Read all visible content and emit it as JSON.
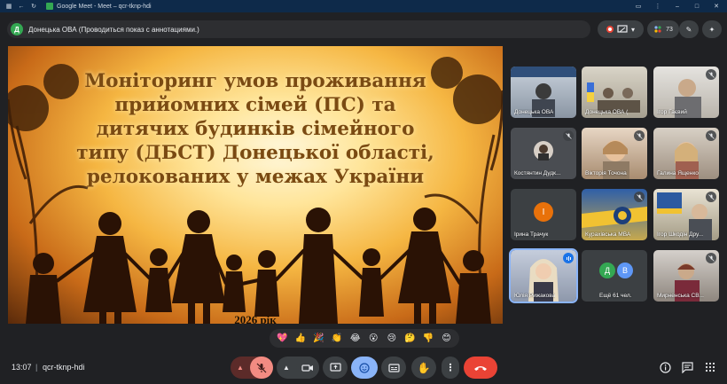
{
  "window": {
    "title": "Google Meet - Meet – qcr-tknp-hdi"
  },
  "presenter": {
    "avatar_letter": "Д",
    "text": "Донецька ОВА (Проводиться показ с аннотациями.)"
  },
  "top_controls": {
    "people_count": "73"
  },
  "slide": {
    "title_lines": [
      "Моніторинг умов проживання",
      "прийомних сімей (ПС) та",
      "дитячих будинків сімейного",
      "типу (ДБСТ) Донецької області,",
      "релокованих у межах України"
    ],
    "year": "2026 рік"
  },
  "participants": [
    {
      "name": "Донецька ОВА",
      "muted": false
    },
    {
      "name": "Донецька ОВА (",
      "muted": false
    },
    {
      "name": "Ігор Гаєвий",
      "muted": true
    },
    {
      "name": "Костянтин Дудк...",
      "muted": true
    },
    {
      "name": "Вікторія Точона",
      "muted": true
    },
    {
      "name": "Галина Ященко",
      "muted": true
    },
    {
      "name": "Ірина Трачук",
      "muted": false,
      "avatar": "І"
    },
    {
      "name": "Курахівська МВА",
      "muted": true
    },
    {
      "name": "Ігор Шкодін Дру...",
      "muted": true
    },
    {
      "name": "Юлія Рижакова",
      "muted": false
    },
    {
      "name": "Ещё 61 чел.",
      "muted": false,
      "avatars": [
        "Д",
        "В"
      ]
    },
    {
      "name": "Мирненська СВ...",
      "muted": true
    }
  ],
  "reactions": [
    "💖",
    "👍",
    "🎉",
    "👏",
    "😂",
    "😮",
    "😢",
    "🤔",
    "👎",
    "😊"
  ],
  "bottom": {
    "time": "13:07",
    "separator": "|",
    "meeting_code": "qcr-tknp-hdi"
  },
  "colors": {
    "accent_blue": "#8ab4f8",
    "end_call_red": "#ea4335",
    "muted_red": "#f28b82"
  }
}
